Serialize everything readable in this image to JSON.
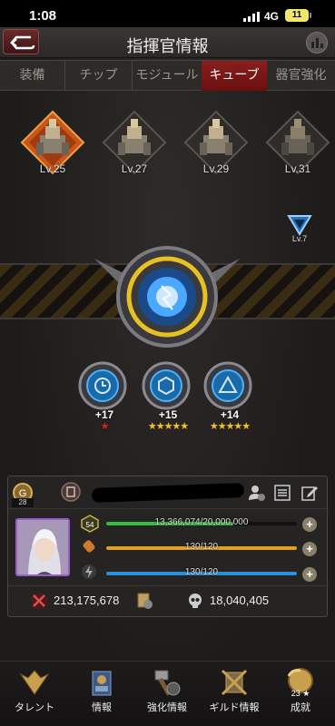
{
  "status_bar": {
    "time": "1:08",
    "network": "4G",
    "battery": "11"
  },
  "header": {
    "title": "指揮官情報"
  },
  "tabs": [
    {
      "label": "装備",
      "active": false
    },
    {
      "label": "チップ",
      "active": false
    },
    {
      "label": "モジュール",
      "active": false
    },
    {
      "label": "キューブ",
      "active": true
    },
    {
      "label": "器官強化",
      "active": false
    }
  ],
  "buildings": [
    {
      "level": "Lv.25",
      "selected": true
    },
    {
      "level": "Lv.27",
      "selected": false
    },
    {
      "level": "Lv.29",
      "selected": false
    },
    {
      "level": "Lv.31",
      "selected": false
    }
  ],
  "cube_badge": {
    "level": "Lv.7"
  },
  "modules": [
    {
      "plus": "+17",
      "stars": "★",
      "star_color": "red"
    },
    {
      "plus": "+15",
      "stars": "★★★★★",
      "star_color": "gold"
    },
    {
      "plus": "+14",
      "stars": "★★★★★",
      "star_color": "gold"
    }
  ],
  "player": {
    "level": "28",
    "avatar_level": "54",
    "exp": {
      "text": "13,366,074/20,000,000",
      "fraction": 0.668
    },
    "stamina": {
      "text": "130/120",
      "fraction": 1.0
    },
    "energy": {
      "text": "130/120",
      "fraction": 1.0
    },
    "power": "213,175,678",
    "kills": "18,040,405"
  },
  "colors": {
    "accent_red": "#8a1e1e",
    "exp_bar": "#2fbf3a",
    "stamina_bar": "#e0a020",
    "energy_bar": "#2a8fd8",
    "star_gold": "#f4c030"
  },
  "nav": [
    {
      "label": "タレント",
      "icon": "talent-icon"
    },
    {
      "label": "情報",
      "icon": "info-icon"
    },
    {
      "label": "強化情報",
      "icon": "upgrade-icon"
    },
    {
      "label": "ギルド情報",
      "icon": "guild-icon"
    },
    {
      "label": "成就",
      "icon": "achievement-icon",
      "count": "23 ★"
    }
  ]
}
